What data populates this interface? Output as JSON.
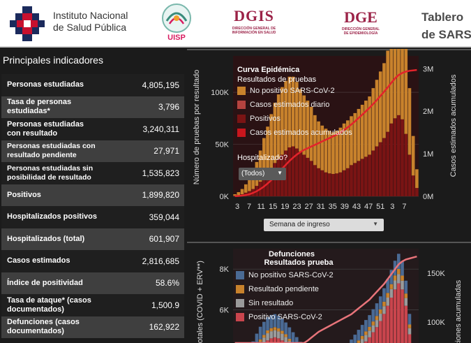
{
  "header": {
    "insp_line1": "Instituto Nacional",
    "insp_line2": "de Salud Pública",
    "uisp": "UISP",
    "dgis_title": "DGIS",
    "dgis_sub1": "DIRECCIÓN GENERAL DE",
    "dgis_sub2": "INFORMACIÓN EN SALUD",
    "dge_title": "DGE",
    "dge_sub1": "DIRECCIÓN GENERAL",
    "dge_sub2": "DE EPIDEMIOLOGÍA",
    "title_line1": "Tablero",
    "title_line2": "de SARS"
  },
  "panel": {
    "title": "Principales indicadores",
    "rows": [
      {
        "label": "Personas estudiadas",
        "value": "4,805,195"
      },
      {
        "label": "Tasa de personas estudiadas*",
        "value": "3,796"
      },
      {
        "label": "Personas estudiadas con resultado",
        "value": "3,240,311"
      },
      {
        "label": "Personas estudiadas con resultado pendiente",
        "value": "27,971"
      },
      {
        "label": "Personas estudiadas sin posibilidad de resultado",
        "value": "1,535,823"
      },
      {
        "label": "Positivos",
        "value": "1,899,820"
      },
      {
        "label": "Hospitalizados positivos",
        "value": "359,044"
      },
      {
        "label": "Hospitalizados (total)",
        "value": "601,907"
      },
      {
        "label": "Casos estimados",
        "value": "2,816,685"
      },
      {
        "label": "Índice de positividad",
        "value": "58.6%"
      },
      {
        "label": "Tasa de ataque* (casos documentados)",
        "value": "1,500.9"
      },
      {
        "label": "Defunciones (casos documentados)",
        "value": "162,922"
      }
    ]
  },
  "chart1": {
    "title": "Curva Epidémica",
    "subtitle": "Resultados de pruebas",
    "legend": [
      {
        "label": "No positivo SARS-CoV-2",
        "color": "#c8822c"
      },
      {
        "label": "Casos estimados diario",
        "color": "#b5433f"
      },
      {
        "label": "Positivos",
        "color": "#7a1414"
      },
      {
        "label": "Casos estimados acumulados",
        "color": "#c8161d"
      }
    ],
    "y_left_label": "Número de pruebas por resultado",
    "y_right_label": "Casos estimados acumulados",
    "y_left_ticks": [
      "0K",
      "50K",
      "100K"
    ],
    "y_right_ticks": [
      "0M",
      "1M",
      "2M",
      "3M"
    ],
    "x_ticks": [
      "3",
      "7",
      "11",
      "15",
      "19",
      "23",
      "27",
      "31",
      "35",
      "39",
      "43",
      "47",
      "51",
      "3",
      "7"
    ],
    "filter_label": "Hospitalizado?",
    "filter_value": "(Todos)",
    "week_select": "Semana de ingreso"
  },
  "chart2": {
    "title": "Defunciones",
    "subtitle": "Resultados prueba",
    "legend": [
      {
        "label": "No positivo SARS-CoV-2",
        "color": "#4a6a94"
      },
      {
        "label": "Resultado pendiente",
        "color": "#c8822c"
      },
      {
        "label": "Sin resultado",
        "color": "#9a9a9a"
      },
      {
        "label": "Positivo SARS-CoV-2",
        "color": "#c9454d"
      }
    ],
    "y_left_label": "s totales (COVID + ERV**)",
    "y_right_label": "ciones acumuladas",
    "y_left_ticks": [
      "4K",
      "6K",
      "8K"
    ],
    "y_right_ticks": [
      "100K",
      "150K"
    ]
  },
  "chart_data": [
    {
      "type": "bar",
      "title": "Curva Epidémica",
      "subtitle": "Resultados de pruebas",
      "ylabel": "Número de pruebas por resultado",
      "y2label": "Casos estimados acumulados",
      "xlabel": "Semana de ingreso",
      "ylim": [
        0,
        135000
      ],
      "y2lim": [
        0,
        3300000
      ],
      "x": [
        9,
        10,
        11,
        12,
        13,
        14,
        15,
        16,
        17,
        18,
        19,
        20,
        21,
        22,
        23,
        24,
        25,
        26,
        27,
        28,
        29,
        30,
        31,
        32,
        33,
        34,
        35,
        36,
        37,
        38,
        39,
        40,
        41,
        42,
        43,
        44,
        45,
        46,
        47,
        48,
        49,
        50,
        51,
        52,
        53,
        1,
        2,
        3,
        4,
        5,
        6
      ],
      "series": [
        {
          "name": "Positivos",
          "values": [
            500,
            1000,
            2000,
            3500,
            5000,
            7000,
            10000,
            14000,
            18000,
            22000,
            27000,
            32000,
            36000,
            40000,
            44000,
            47000,
            48000,
            46000,
            43000,
            40000,
            37000,
            34000,
            30000,
            27000,
            25000,
            23000,
            22000,
            21500,
            22000,
            23000,
            25000,
            27000,
            30000,
            32000,
            34000,
            36000,
            38000,
            40000,
            44000,
            48000,
            52000,
            56000,
            62000,
            70000,
            75000,
            78000,
            74000,
            60000,
            40000,
            20000,
            8000
          ]
        },
        {
          "name": "No positivo SARS-CoV-2",
          "values": [
            1500,
            3000,
            5000,
            8000,
            12000,
            17000,
            23000,
            30000,
            38000,
            45000,
            52000,
            58000,
            62000,
            65000,
            67000,
            68000,
            67000,
            64000,
            60000,
            57000,
            55000,
            52000,
            48000,
            45000,
            43000,
            42000,
            41000,
            40000,
            41000,
            43000,
            45000,
            46000,
            47000,
            48000,
            50000,
            52000,
            54000,
            56000,
            60000,
            64000,
            68000,
            72000,
            78000,
            88000,
            100000,
            108000,
            104000,
            88000,
            64000,
            38000,
            18000
          ]
        },
        {
          "name": "Casos estimados acumulados",
          "values": [
            3000,
            8000,
            16000,
            30000,
            50000,
            80000,
            120000,
            170000,
            230000,
            300000,
            380000,
            470000,
            560000,
            650000,
            740000,
            830000,
            910000,
            980000,
            1040000,
            1090000,
            1130000,
            1170000,
            1210000,
            1250000,
            1290000,
            1330000,
            1370000,
            1410000,
            1450000,
            1500000,
            1560000,
            1620000,
            1690000,
            1760000,
            1840000,
            1920000,
            2000000,
            2080000,
            2170000,
            2260000,
            2360000,
            2460000,
            2560000,
            2670000,
            2770000,
            2850000,
            2900000,
            2930000,
            2950000,
            2960000,
            2970000
          ]
        }
      ]
    },
    {
      "type": "bar",
      "title": "Defunciones",
      "subtitle": "Resultados prueba",
      "ylabel": "s totales (COVID + ERV**)",
      "y2label": "ciones acumuladas",
      "ylim": [
        3000,
        9000
      ],
      "y2lim": [
        50000,
        175000
      ],
      "x": [
        9,
        10,
        11,
        12,
        13,
        14,
        15,
        16,
        17,
        18,
        19,
        20,
        21,
        22,
        23,
        24,
        25,
        26,
        27,
        28,
        29,
        30,
        31,
        32,
        33,
        34,
        35,
        36,
        37,
        38,
        39,
        40,
        41,
        42,
        43,
        44,
        45,
        46,
        47,
        48,
        49,
        50,
        51,
        52,
        53,
        1,
        2,
        3,
        4,
        5,
        6
      ],
      "series": [
        {
          "name": "Positivo SARS-CoV-2",
          "values": [
            2600,
            2700,
            2800,
            3000,
            3200,
            3500,
            3800,
            4100,
            4300,
            4500,
            4600,
            4650,
            4600,
            4500,
            4350,
            4150,
            3950,
            3750,
            3550,
            3400,
            3300,
            3200,
            3100,
            3000,
            2950,
            2900,
            2900,
            2950,
            3000,
            3100,
            3250,
            3450,
            3650,
            3850,
            4050,
            4250,
            4450,
            4650,
            4900,
            5150,
            5450,
            5800,
            6200,
            6600,
            7000,
            7300,
            7000,
            6200,
            4800,
            3500,
            2800
          ]
        },
        {
          "name": "Sin resultado",
          "values": [
            200,
            220,
            240,
            260,
            280,
            300,
            320,
            330,
            340,
            350,
            350,
            350,
            340,
            330,
            320,
            310,
            300,
            290,
            280,
            270,
            260,
            250,
            240,
            230,
            220,
            220,
            220,
            230,
            240,
            250,
            260,
            270,
            280,
            290,
            300,
            310,
            320,
            330,
            340,
            350,
            360,
            380,
            400,
            420,
            440,
            450,
            430,
            380,
            300,
            220,
            180
          ]
        },
        {
          "name": "Resultado pendiente",
          "values": [
            50,
            60,
            70,
            80,
            90,
            100,
            110,
            120,
            130,
            140,
            150,
            150,
            150,
            140,
            130,
            120,
            110,
            100,
            100,
            100,
            100,
            100,
            100,
            100,
            100,
            100,
            100,
            100,
            100,
            100,
            110,
            120,
            130,
            140,
            150,
            160,
            170,
            180,
            190,
            200,
            210,
            220,
            230,
            240,
            250,
            260,
            250,
            220,
            180,
            140,
            110
          ]
        },
        {
          "name": "No positivo SARS-CoV-2",
          "values": [
            300,
            350,
            400,
            450,
            500,
            550,
            600,
            620,
            640,
            650,
            650,
            640,
            620,
            600,
            580,
            560,
            540,
            520,
            500,
            480,
            460,
            440,
            420,
            400,
            390,
            380,
            380,
            390,
            400,
            420,
            440,
            460,
            480,
            500,
            520,
            540,
            560,
            580,
            600,
            620,
            640,
            660,
            680,
            700,
            720,
            740,
            710,
            630,
            520,
            400,
            300
          ]
        }
      ],
      "line": {
        "name": "Defunciones acumuladas",
        "values": [
          1000,
          2000,
          3500,
          6000,
          10000,
          15000,
          20000,
          25000,
          30000,
          35000,
          40000,
          45000,
          50000,
          55000,
          59000,
          63000,
          67000,
          71000,
          75000,
          78000,
          81000,
          84000,
          87000,
          90000,
          92000,
          94000,
          96000,
          98000,
          100000,
          102000,
          104000,
          106000,
          108000,
          111000,
          114000,
          117000,
          120000,
          123000,
          127000,
          131000,
          135000,
          139000,
          144000,
          149000,
          154000,
          159000,
          162000,
          164000,
          165000,
          166000,
          167000
        ]
      }
    }
  ]
}
